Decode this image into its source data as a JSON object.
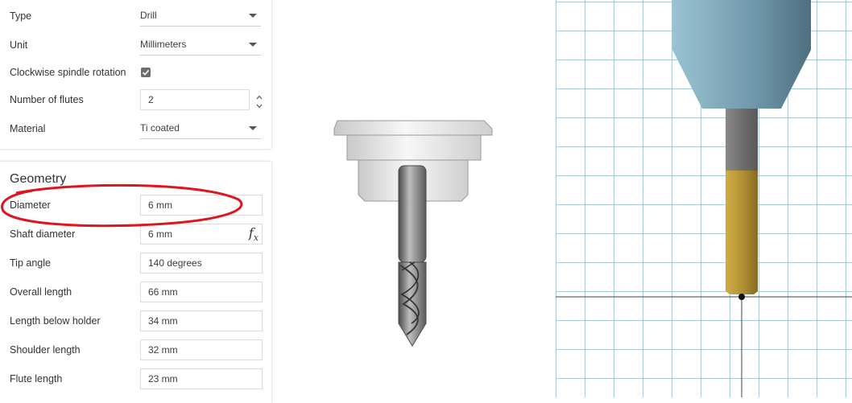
{
  "general": {
    "type": {
      "label": "Type",
      "value": "Drill"
    },
    "unit": {
      "label": "Unit",
      "value": "Millimeters"
    },
    "clockwise": {
      "label": "Clockwise spindle rotation",
      "checked": true
    },
    "flutes": {
      "label": "Number of flutes",
      "value": "2"
    },
    "material": {
      "label": "Material",
      "value": "Ti coated"
    }
  },
  "geometry": {
    "title": "Geometry",
    "fields": [
      {
        "label": "Diameter",
        "value": "6 mm"
      },
      {
        "label": "Shaft diameter",
        "value": "6 mm",
        "fx_label": "f",
        "fx_sub": "x"
      },
      {
        "label": "Tip angle",
        "value": "140 degrees"
      },
      {
        "label": "Overall length",
        "value": "66 mm"
      },
      {
        "label": "Length below holder",
        "value": "34 mm"
      },
      {
        "label": "Shoulder length",
        "value": "32 mm"
      },
      {
        "label": "Flute length",
        "value": "23 mm"
      }
    ]
  },
  "colors": {
    "annotation": "#e0141e",
    "holder_blue": "#7fa8b9",
    "tool_gold": "#b39236",
    "grid_line": "#a7cbd6"
  },
  "icons": {
    "dropdown": "chevron-down-icon",
    "checkbox": "checkmark-icon",
    "stepper": "stepper-arrows-icon",
    "formula": "fx-icon"
  }
}
